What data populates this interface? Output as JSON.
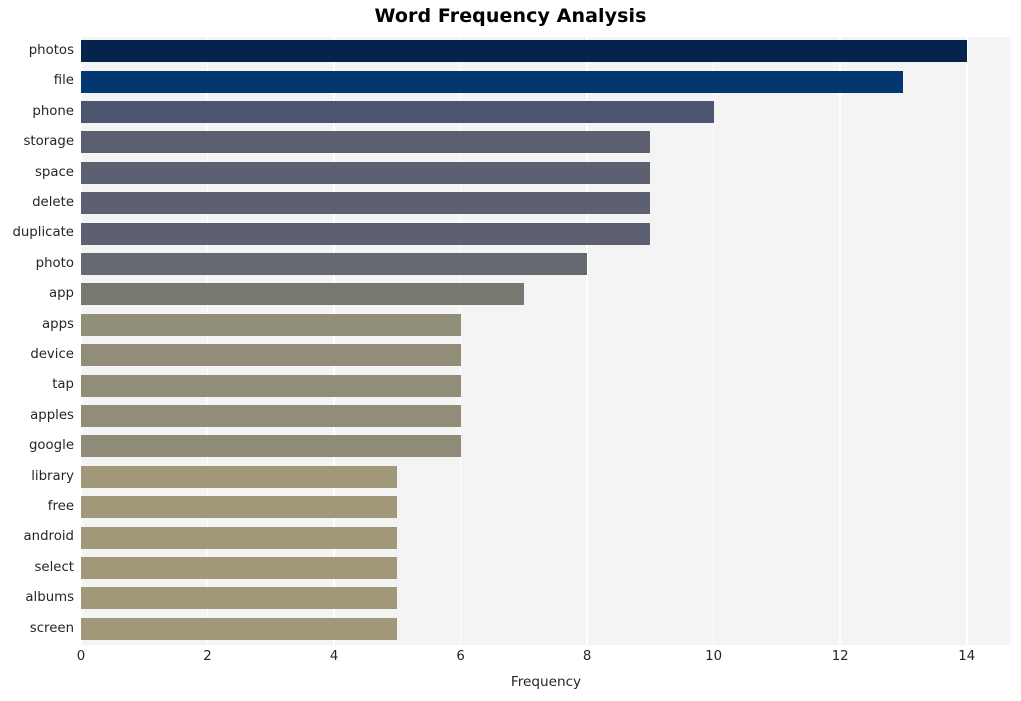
{
  "chart_data": {
    "type": "bar",
    "orientation": "horizontal",
    "title": "Word Frequency Analysis",
    "xlabel": "Frequency",
    "ylabel": "",
    "categories": [
      "photos",
      "file",
      "phone",
      "storage",
      "space",
      "delete",
      "duplicate",
      "photo",
      "app",
      "apps",
      "device",
      "tap",
      "apples",
      "google",
      "library",
      "free",
      "android",
      "select",
      "albums",
      "screen"
    ],
    "values": [
      14,
      13,
      10,
      9,
      9,
      9,
      9,
      8,
      7,
      6,
      6,
      6,
      6,
      6,
      5,
      5,
      5,
      5,
      5,
      5
    ],
    "bar_colors": [
      "#04234d",
      "#02386f",
      "#4d5470",
      "#5b5f70",
      "#5c6070",
      "#5c6070",
      "#5c6070",
      "#666970",
      "#77786f",
      "#918e79",
      "#918d78",
      "#918d78",
      "#918d78",
      "#8f8b78",
      "#a09878",
      "#a09878",
      "#a09878",
      "#a09878",
      "#a09878",
      "#a09878"
    ],
    "xlim": [
      0,
      14.7
    ],
    "xticks": [
      0,
      2,
      4,
      6,
      8,
      10,
      12,
      14
    ],
    "xtick_labels": [
      "0",
      "2",
      "4",
      "6",
      "8",
      "10",
      "12",
      "14"
    ],
    "grid": true,
    "grid_axis": "x",
    "grid_color": "#ffffff",
    "plot_background": "#f4f4f5",
    "figure_background": "#ffffff",
    "legend": null,
    "tick_label_color": "#262626",
    "title_color": "#000000"
  }
}
